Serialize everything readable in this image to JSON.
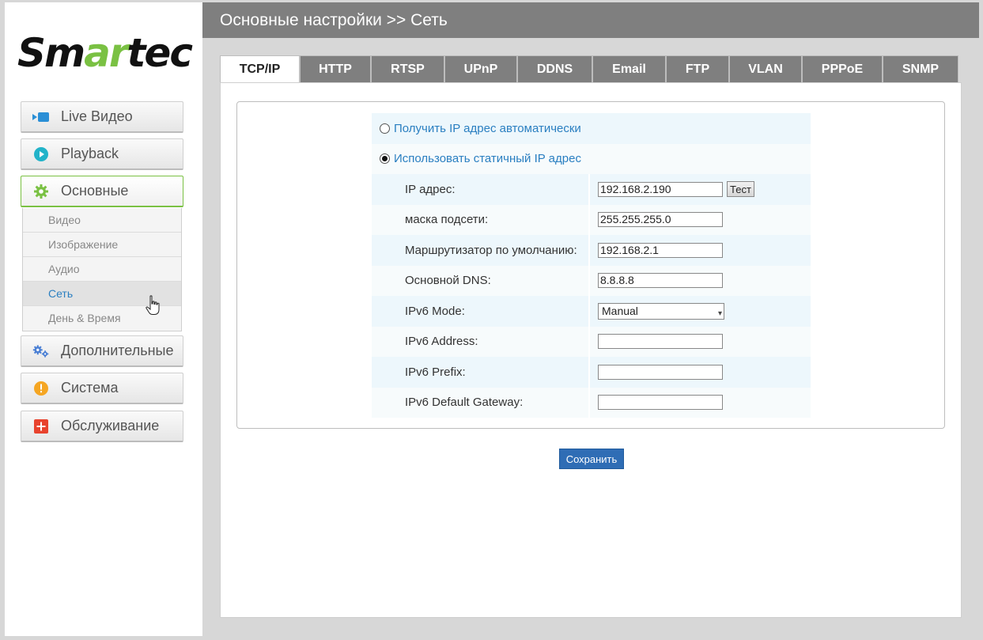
{
  "logo": {
    "part1": "Sm",
    "part2": "ar",
    "part3": "tec"
  },
  "sidebar": {
    "live": "Live Видео",
    "playback": "Playback",
    "basic": "Основные",
    "submenu": [
      "Видео",
      "Изображение",
      "Аудио",
      "Сеть",
      "День & Время"
    ],
    "advanced": "Дополнительные",
    "system": "Система",
    "maintenance": "Обслуживание"
  },
  "header": {
    "title": "Основные настройки >> Сеть"
  },
  "tabs": [
    "TCP/IP",
    "HTTP",
    "RTSP",
    "UPnP",
    "DDNS",
    "Email",
    "FTP",
    "VLAN",
    "PPPoE",
    "SNMP"
  ],
  "form": {
    "radio_auto": "Получить IP адрес автоматически",
    "radio_static": "Использовать статичный IP адрес",
    "ip_label": "IP адрес:",
    "ip_value": "192.168.2.190",
    "test_button": "Тест",
    "mask_label": "маска подсети:",
    "mask_value": "255.255.255.0",
    "gateway_label": "Маршрутизатор по умолчанию:",
    "gateway_value": "192.168.2.1",
    "dns_label": "Основной DNS:",
    "dns_value": "8.8.8.8",
    "ipv6_mode_label": "IPv6 Mode:",
    "ipv6_mode_value": "Manual",
    "ipv6_address_label": "IPv6 Address:",
    "ipv6_address_value": "",
    "ipv6_prefix_label": "IPv6 Prefix:",
    "ipv6_prefix_value": "",
    "ipv6_gateway_label": "IPv6 Default Gateway:",
    "ipv6_gateway_value": ""
  },
  "save_button": "Сохранить",
  "colors": {
    "accent_green": "#7ac143",
    "link_blue": "#2a7fc1",
    "header_gray": "#7f7f7f",
    "save_blue": "#2f6db5"
  }
}
